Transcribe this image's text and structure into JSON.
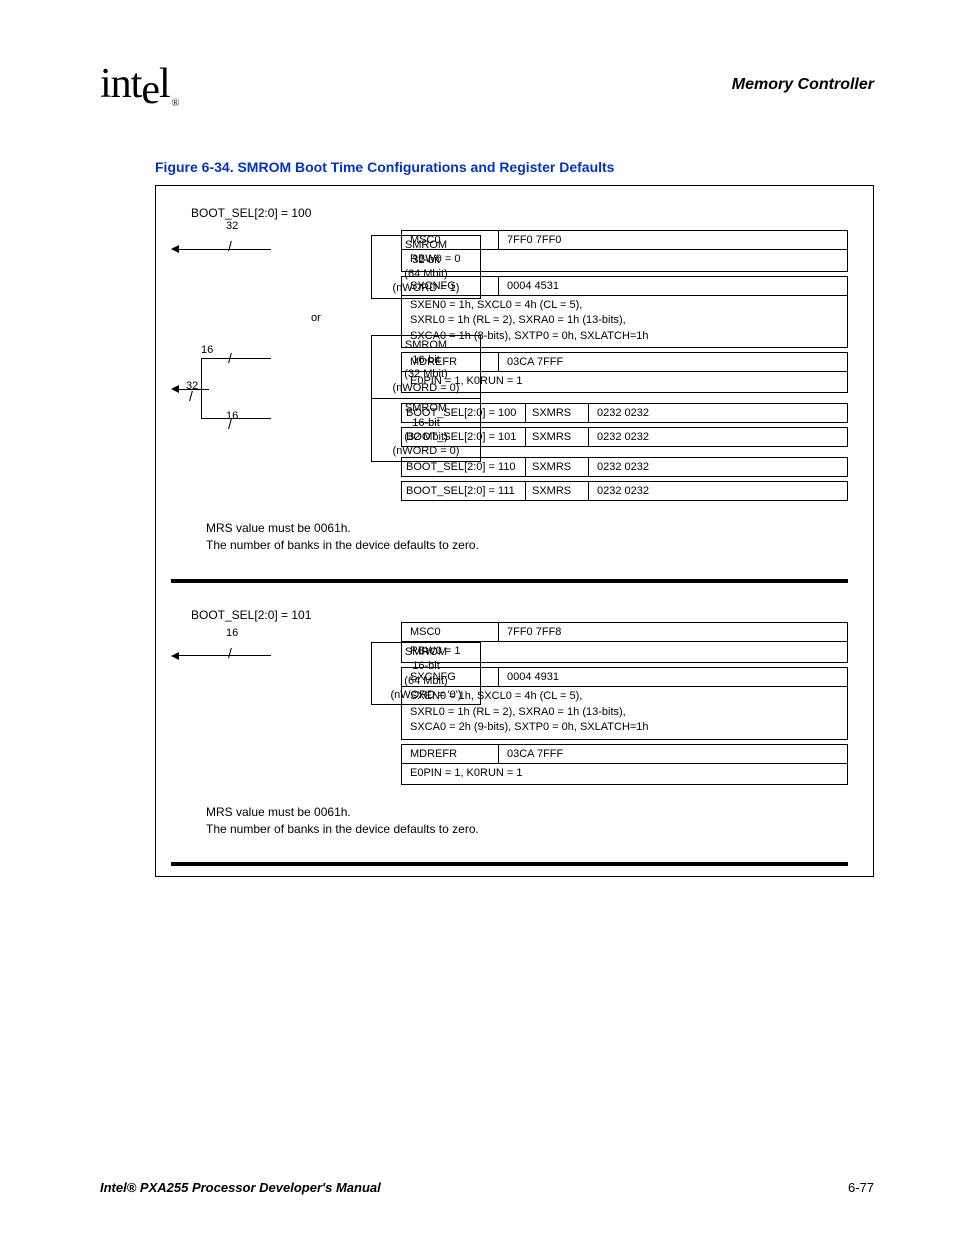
{
  "header": {
    "logo_text": "int",
    "logo_text2": "l",
    "reg_mark": "®",
    "section": "Memory Controller"
  },
  "figure_caption": "Figure 6-34. SMROM Boot Time Configurations and Register Defaults",
  "config100": {
    "heading": "BOOT_SEL[2:0] = 100",
    "bus32": "32",
    "bus16": "16",
    "or": "or",
    "smrom1": {
      "l1": "SMROM",
      "l2": "32-bit",
      "l3": "(64 Mbit)",
      "l4": "(nWORD = 1)"
    },
    "smrom2": {
      "l1": "SMROM",
      "l2": "16-bit",
      "l3": "(32 Mbit)",
      "l4": "(nWORD = 0)"
    },
    "smrom3": {
      "l1": "SMROM",
      "l2": "16-bit",
      "l3": "(32 Mbit)",
      "l4": "(nWORD = 0)"
    },
    "msc0": {
      "label": "MSC0",
      "val": "7FF0 7FF0"
    },
    "rbw0": "RBW0 = 0",
    "sxcnfg": {
      "label": "SXCNFG",
      "val": "0004 4531"
    },
    "sx_detail": [
      "SXEN0 = 1h, SXCL0 = 4h (CL = 5),",
      "SXRL0 = 1h (RL = 2), SXRA0 = 1h (13-bits),",
      "SXCA0 = 1h (8-bits), SXTP0 = 0h, SXLATCH=1h"
    ],
    "mdrefr": {
      "label": "MDREFR",
      "val": "03CA 7FFF"
    },
    "md_detail": "E0PIN = 1, K0RUN = 1",
    "bootrows": [
      {
        "b": "BOOT_SEL[2:0] = 100",
        "r": "SXMRS",
        "v": "0232 0232"
      },
      {
        "b": "BOOT_SEL[2:0] = 101",
        "r": "SXMRS",
        "v": "0232 0232"
      },
      {
        "b": "BOOT_SEL[2:0] = 110",
        "r": "SXMRS",
        "v": "0232 0232"
      },
      {
        "b": "BOOT_SEL[2:0] = 111",
        "r": "SXMRS",
        "v": "0232 0232"
      }
    ],
    "note1": "MRS value must be 0061h.",
    "note2": "The number of banks in the device defaults to zero."
  },
  "config101": {
    "heading": "BOOT_SEL[2:0] = 101",
    "bus16": "16",
    "smrom1": {
      "l1": "SMROM",
      "l2": "16-bit",
      "l3": "(64 Mbit)",
      "l4": "(nWORD = '0')"
    },
    "msc0": {
      "label": "MSC0",
      "val": "7FF0 7FF8"
    },
    "rbw0": "RBW0 = 1",
    "sxcnfg": {
      "label": "SXCNFG",
      "val": "0004 4931"
    },
    "sx_detail": [
      "SXEN0 = 1h, SXCL0 = 4h (CL = 5),",
      "SXRL0 = 1h (RL = 2), SXRA0 = 1h (13-bits),",
      "SXCA0 = 2h (9-bits), SXTP0 = 0h, SXLATCH=1h"
    ],
    "mdrefr": {
      "label": "MDREFR",
      "val": "03CA 7FFF"
    },
    "md_detail": "E0PIN = 1, K0RUN = 1",
    "note1": "MRS value must be 0061h.",
    "note2": "The number of banks in the device defaults to zero."
  },
  "footer": {
    "left": "Intel® PXA255 Processor Developer's Manual",
    "right": "6-77"
  }
}
